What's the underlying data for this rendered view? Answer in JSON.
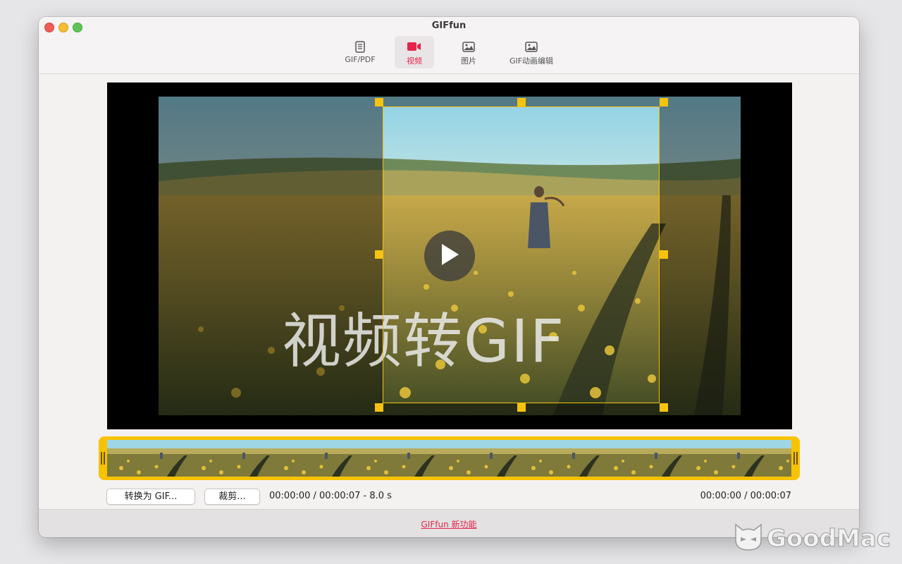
{
  "window": {
    "title": "GIFfun"
  },
  "toolbar": {
    "items": [
      {
        "label": "GIF/PDF",
        "icon": "document-icon",
        "active": false
      },
      {
        "label": "视频",
        "icon": "video-camera-icon",
        "active": true
      },
      {
        "label": "图片",
        "icon": "image-icon",
        "active": false
      },
      {
        "label": "GIF动画编辑",
        "icon": "image-icon",
        "active": false
      }
    ]
  },
  "player": {
    "overlay_text": "视频转GIF",
    "play_icon": "play-icon"
  },
  "timeline": {
    "thumbnail_count": 9
  },
  "controls": {
    "convert_button": "转换为 GIF...",
    "crop_button": "裁剪...",
    "range_text": "00:00:00 / 00:00:07 - 8.0 s",
    "position_text": "00:00:00 / 00:00:07"
  },
  "footer": {
    "link_text": "GIFfun 新功能"
  },
  "watermark": {
    "text": "GoodMac"
  },
  "colors": {
    "accent": "#e6244a",
    "crop_yellow": "#f6c30e",
    "timeline_yellow": "#f7c300"
  }
}
